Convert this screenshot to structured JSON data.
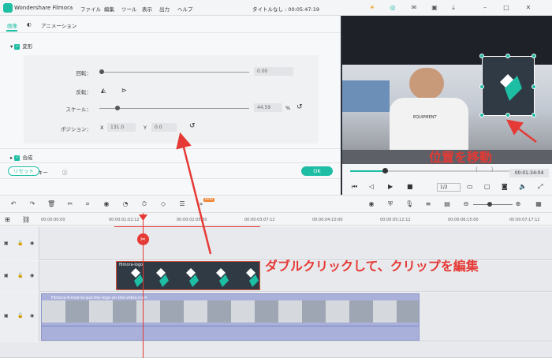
{
  "titlebar": {
    "app_name": "Wondershare Filmora",
    "menu": [
      "ファイル",
      "編集",
      "ツール",
      "表示",
      "出力",
      "ヘルプ"
    ],
    "project": "タイトルなし : 00:05:47:19"
  },
  "left_panel": {
    "tabs": [
      "画像",
      "アニメーション"
    ],
    "sections": {
      "transform": "変形",
      "composite": "合成",
      "chroma": "クロマキー"
    },
    "rotate": {
      "label": "回転：",
      "value": "0.00"
    },
    "flip": {
      "label": "反転："
    },
    "scale": {
      "label": "スケール：",
      "value": "44.59",
      "unit": "%",
      "level": 0.12
    },
    "position": {
      "label": "ポジション：",
      "x_label": "X",
      "x_value": "131.0",
      "y_label": "Y",
      "y_value": "0.0"
    },
    "reset_label": "リセット",
    "ok_label": "OK"
  },
  "preview": {
    "shirt_text": "EQUIPMENT",
    "time": "00:01:34:04",
    "quality": "1/2",
    "progress": 0.2,
    "bracket_left": "{",
    "bracket_right": "}"
  },
  "toolbar": {
    "badge": "Beta"
  },
  "timeline": {
    "ticks": [
      "00:00:00:00",
      "00:00:01:02:12",
      "00:00:02:05:00",
      "00:00:03:07:12",
      "00:00:04:10:00",
      "00:00:05:12:12",
      "00:00:06:15:00",
      "00:00:07:17:12"
    ],
    "logo_clip_name": "filmora-logo",
    "video_clip_name": "Filmora-9-how-to-put-the-logo-on-the-video.mp4"
  },
  "annotations": {
    "move_position": "位置を移動",
    "double_click": "ダブルクリックして、クリップを編集"
  },
  "colors": {
    "accent": "#1ebea5",
    "annotation": "#e53935"
  }
}
